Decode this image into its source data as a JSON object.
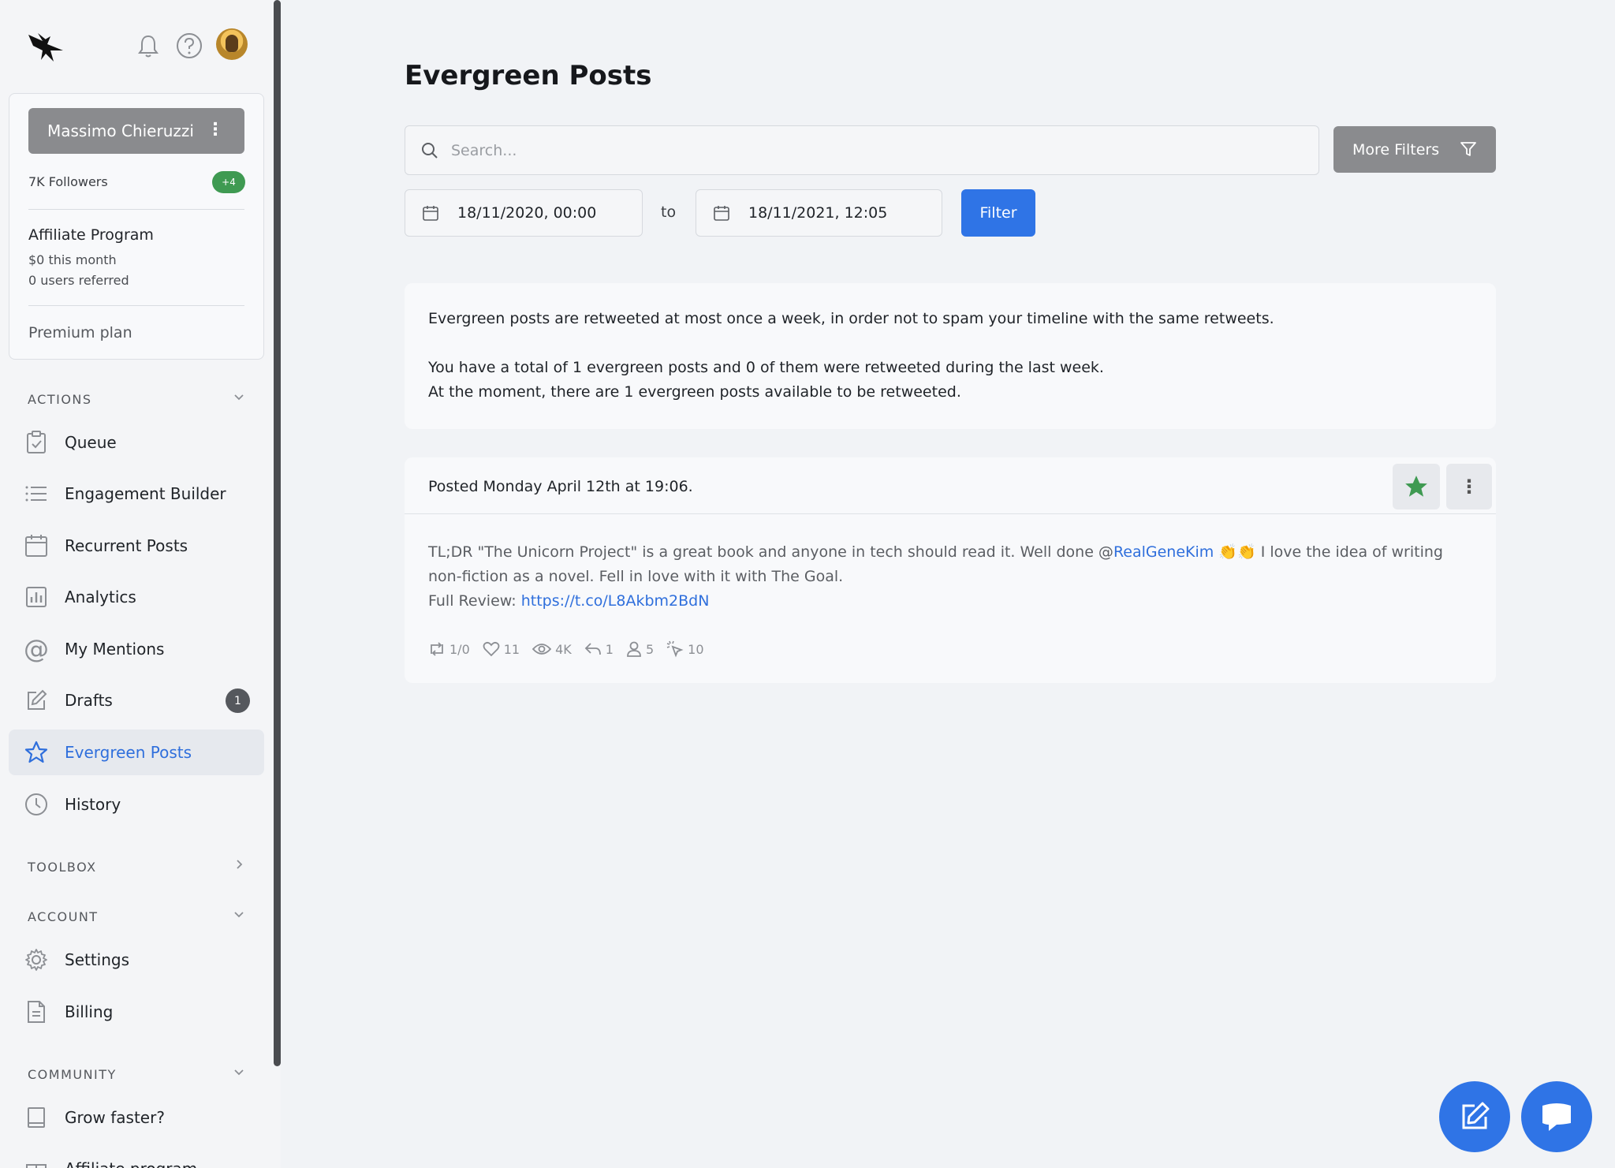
{
  "sidebar": {
    "account": {
      "name": "Massimo Chieruzzi",
      "followers": "7K Followers",
      "extra_accounts": "+4"
    },
    "affiliate": {
      "title": "Affiliate Program",
      "earnings": "$0 this month",
      "referred": "0 users referred"
    },
    "plan": "Premium plan",
    "sections": {
      "actions": "ACTIONS",
      "toolbox": "TOOLBOX",
      "account": "ACCOUNT",
      "community": "COMMUNITY"
    },
    "actions": [
      {
        "label": "Queue",
        "icon": "clipboard-check-icon"
      },
      {
        "label": "Engagement Builder",
        "icon": "list-icon"
      },
      {
        "label": "Recurrent Posts",
        "icon": "calendar-icon"
      },
      {
        "label": "Analytics",
        "icon": "bar-chart-icon"
      },
      {
        "label": "My Mentions",
        "icon": "at-sign-icon"
      },
      {
        "label": "Drafts",
        "icon": "edit-icon",
        "badge": "1"
      },
      {
        "label": "Evergreen Posts",
        "icon": "star-icon",
        "active": true
      },
      {
        "label": "History",
        "icon": "clock-icon"
      }
    ],
    "account_items": [
      {
        "label": "Settings",
        "icon": "gear-icon"
      },
      {
        "label": "Billing",
        "icon": "document-icon"
      }
    ],
    "community_items": [
      {
        "label": "Grow faster?",
        "icon": "book-icon"
      },
      {
        "label": "Affiliate program",
        "icon": "gift-icon"
      }
    ]
  },
  "main": {
    "title": "Evergreen Posts",
    "search_placeholder": "Search...",
    "more_filters": "More Filters",
    "date_from": "18/11/2020, 00:00",
    "date_to_label": "to",
    "date_to": "18/11/2021, 12:05",
    "filter_button": "Filter",
    "info": {
      "line1": "Evergreen posts are retweeted at most once a week, in order not to spam your timeline with the same retweets.",
      "line2": "You have a total of 1 evergreen posts and 0 of them were retweeted during the last week.",
      "line3": "At the moment, there are 1 evergreen posts available to be retweeted."
    },
    "post": {
      "posted": "Posted Monday April 12th at 19:06.",
      "text_before": "TL;DR \"The Unicorn Project\" is a great book and anyone in tech should read it. Well done @",
      "mention": "RealGeneKim",
      "emoji": "👏👏",
      "text_after": " I love the idea of writing non-fiction as a novel. Fell in love with it with The Goal.",
      "review_label": "Full Review: ",
      "review_link": "https://t.co/L8Akbm2BdN",
      "stats": {
        "retweets": "1/0",
        "likes": "11",
        "views": "4K",
        "replies": "1",
        "profile_clicks": "5",
        "clicks": "10"
      }
    }
  },
  "colors": {
    "accent": "#2f74e6",
    "active_text": "#2f6fdc",
    "star": "#3f9a52",
    "gray_button": "#8a8b8e"
  }
}
